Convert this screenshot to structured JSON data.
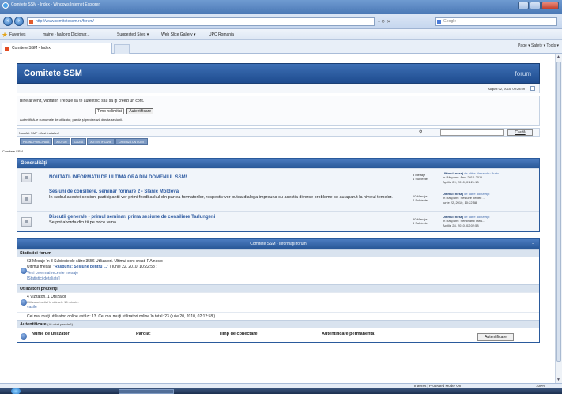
{
  "window": {
    "title": "Comitete SSM - Index - Windows Internet Explorer"
  },
  "address_bar": {
    "url": "http://www.comitetessm.ro/forum/",
    "search_placeholder": "Google"
  },
  "favorites": {
    "label": "Favorites",
    "items": [
      "maine - hallo.ro Dicţionar...",
      "Suggested Sites ▾",
      "Web Slice Gallery ▾",
      "UPC Romania"
    ]
  },
  "tab": {
    "title": "Comitete SSM - Index"
  },
  "command_bar": "Page ▾   Safety ▾   Tools ▾",
  "forum": {
    "title": "Comitete SSM",
    "tagline": "forum",
    "datetime": "August 02, 2010, 09:23:59",
    "welcome_line": "Bine ai venit, Vizitator. Trebuie să te autentifici sau să îţi creezi un cont.",
    "login_select": "Timp nelimitat",
    "login_button": "Autentificare",
    "login_hint": "Autentifică-te cu numele de utilizator, parola şi precizează durata sesiunii.",
    "news": "Noutăţi: SMF - Just Installed!",
    "search_button": "Caută",
    "nav_tabs": [
      "PAGINA PRINCIPALĂ",
      "AJUTOR",
      "CAUTĂ",
      "AUTENTIFICARE",
      "CREEAZĂ UN CONT"
    ],
    "breadcrumb": "Comitete SSM",
    "category": {
      "title": "Generalităţi",
      "boards": [
        {
          "title": "NOUTATI- INFORMATII DE ULTIMA ORA DIN DOMENIUL SSM!",
          "description": "",
          "posts": "3 Mesaje",
          "topics": "1 Subiecte",
          "last_label": "Ultimul mesaj",
          "last_by": "de către Alexandru Bratu",
          "last_in": "în Răspuns: Anul 2010-2011 ...",
          "last_date": "Aprilie 29, 2010, 01:21:13"
        },
        {
          "title": "Sesiuni de consiliere, seminar formare 2 - Slanic Moldova",
          "description": "In cadrul acestei sectiuni participantii vor primi feedbackul din partea formatorilor, respectiv vor putea dialoga impreuna cu acestia diverse probleme ce au aparut la nivelul temelor.",
          "posts": "10 Mesaje",
          "topics": "2 Subiecte",
          "last_label": "Ultimul mesaj",
          "last_by": "de către adinavlipi",
          "last_in": "în Răspuns: Sesiune pentru ...",
          "last_date": "Iunie 22, 2010, 10:22:58"
        },
        {
          "title": "Discutii generale - primul seminar/ prima sesiune de consiliere Tarlungeni",
          "description": "Se pot aborda dicutii pe orice tema.",
          "posts": "50 Mesaje",
          "topics": "5 Subiecte",
          "last_label": "Ultimul mesaj",
          "last_by": "de către adinavlipi",
          "last_in": "în Răspuns: Seminarul Tarlu...",
          "last_date": "Aprilie 28, 2010, 02:02:58"
        }
      ]
    },
    "info": {
      "header": "Comitete SSM - Informaţii forum",
      "collapse": "−",
      "stats_title": "Statistici forum",
      "stats_line1": "63 Mesaje în 8 Subiecte de către 3556 Utilizatori. Ultimul cont creat: RAinesio",
      "stats_line2_prefix": "Ultimul mesaj:",
      "stats_line2_link": "\"Răspuns: Sesiune pentru ...\"",
      "stats_line2_suffix": " ( Iunie 22, 2010, 10:22:58 )",
      "stats_recent": "Vezi cele mai recente mesaje",
      "stats_detail": "[Statistici detaliate]",
      "online_title": "Utilizatori prezenţi",
      "online_line1": "4 Vizitatori, 1 Utilizator",
      "online_line2": "Utilizatori activi în ultimele 15 minute:",
      "online_user": "vasile",
      "online_record": "Cei mai mulţi utilizatori online astăzi: 13. Cei mai mulţi utilizatori online în total: 23 (Iulie 20, 2010, 02:12:58 )",
      "auth_title": "Autentificare",
      "auth_lost": "(Ai uitat parola?)",
      "auth_user": "Nume de utilizator:",
      "auth_pass": "Parola:",
      "auth_time": "Timp de conectare:",
      "auth_perm": "Autentificare permanentă:",
      "auth_button": "Autentificare"
    }
  },
  "status_bar": {
    "zone": "Internet | Protected Mode: On",
    "zoom": "100%"
  }
}
